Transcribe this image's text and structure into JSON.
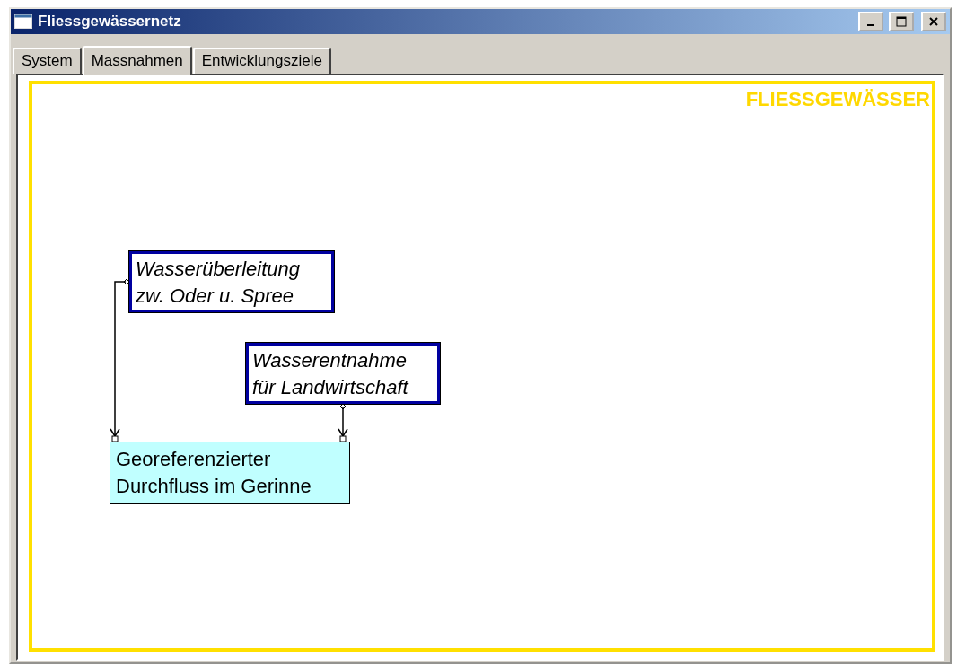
{
  "window": {
    "title": "Fliessgewässernetz"
  },
  "tabs": [
    {
      "label": "System",
      "selected": false
    },
    {
      "label": "Massnahmen",
      "selected": true
    },
    {
      "label": "Entwicklungsziele",
      "selected": false
    }
  ],
  "canvas": {
    "label": "FLIESSGEWÄSSER",
    "nodes": [
      {
        "kind": "measure",
        "lines": [
          "Wasserüberleitung",
          "zw. Oder u. Spree"
        ]
      },
      {
        "kind": "measure",
        "lines": [
          "Wasserentnahme",
          "für Landwirtschaft"
        ]
      },
      {
        "kind": "state",
        "lines": [
          "Georeferenzierter",
          "Durchfluss im Gerinne"
        ]
      }
    ]
  }
}
